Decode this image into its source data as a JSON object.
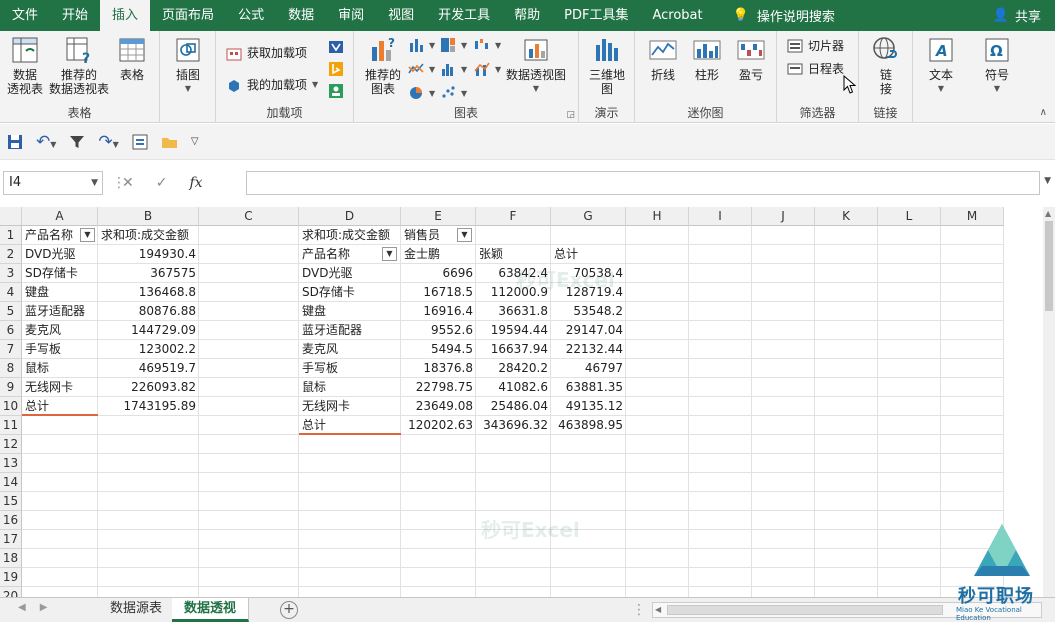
{
  "ribbon_tabs": [
    "文件",
    "开始",
    "插入",
    "页面布局",
    "公式",
    "数据",
    "审阅",
    "视图",
    "开发工具",
    "帮助",
    "PDF工具集",
    "Acrobat"
  ],
  "active_tab_index": 2,
  "tell_me": "操作说明搜索",
  "share": "共享",
  "groups": {
    "tables": {
      "label": "表格",
      "pivot": "数据\n透视表",
      "recommended_pivot": "推荐的\n数据透视表",
      "table": "表格"
    },
    "illustrations": {
      "label": "",
      "button": "插图"
    },
    "addins": {
      "label": "加载项",
      "get": "获取加载项",
      "my": "我的加载项"
    },
    "charts": {
      "label": "图表",
      "recommended": "推荐的\n图表",
      "pivot_chart": "数据透视图"
    },
    "tours": {
      "label": "演示",
      "map3d": "三维地\n图"
    },
    "sparklines": {
      "label": "迷你图",
      "line": "折线",
      "column": "柱形",
      "winloss": "盈亏"
    },
    "filters": {
      "label": "筛选器",
      "slicer": "切片器",
      "timeline": "日程表"
    },
    "links": {
      "label": "链接",
      "link": "链\n接"
    },
    "text": {
      "button": "文本"
    },
    "symbols": {
      "button": "符号"
    }
  },
  "namebox": "I4",
  "fx": "fx",
  "columns": [
    {
      "label": "A",
      "w": 76
    },
    {
      "label": "B",
      "w": 101
    },
    {
      "label": "C",
      "w": 100
    },
    {
      "label": "D",
      "w": 102
    },
    {
      "label": "E",
      "w": 75
    },
    {
      "label": "F",
      "w": 75
    },
    {
      "label": "G",
      "w": 75
    },
    {
      "label": "H",
      "w": 63
    },
    {
      "label": "I",
      "w": 63
    },
    {
      "label": "J",
      "w": 63
    },
    {
      "label": "K",
      "w": 63
    },
    {
      "label": "L",
      "w": 63
    },
    {
      "label": "M",
      "w": 63
    }
  ],
  "row_numbers": [
    "1",
    "2",
    "3",
    "4",
    "5",
    "6",
    "7",
    "8",
    "9",
    "10",
    "11",
    "12",
    "13",
    "14",
    "15",
    "16",
    "17",
    "18",
    "19",
    "20"
  ],
  "pivot1": {
    "header_label": "产品名称",
    "value_header": "求和项:成交金额",
    "rows": [
      [
        "DVD光驱",
        "194930.4"
      ],
      [
        "SD存储卡",
        "367575"
      ],
      [
        "键盘",
        "136468.8"
      ],
      [
        "蓝牙适配器",
        "80876.88"
      ],
      [
        "麦克风",
        "144729.09"
      ],
      [
        "手写板",
        "123002.2"
      ],
      [
        "鼠标",
        "469519.7"
      ],
      [
        "无线网卡",
        "226093.82"
      ],
      [
        "总计",
        "1743195.89"
      ]
    ]
  },
  "pivot2": {
    "value_header": "求和项:成交金额",
    "col_field": "销售员",
    "row_field": "产品名称",
    "col_headers": [
      "金士鹏",
      "张颖",
      "总计"
    ],
    "rows": [
      [
        "DVD光驱",
        "6696",
        "63842.4",
        "70538.4"
      ],
      [
        "SD存储卡",
        "16718.5",
        "112000.9",
        "128719.4"
      ],
      [
        "键盘",
        "16916.4",
        "36631.8",
        "53548.2"
      ],
      [
        "蓝牙适配器",
        "9552.6",
        "19594.44",
        "29147.04"
      ],
      [
        "麦克风",
        "5494.5",
        "16637.94",
        "22132.44"
      ],
      [
        "手写板",
        "18376.8",
        "28420.2",
        "46797"
      ],
      [
        "鼠标",
        "22798.75",
        "41082.6",
        "63881.35"
      ],
      [
        "无线网卡",
        "23649.08",
        "25486.04",
        "49135.12"
      ],
      [
        "总计",
        "120202.63",
        "343696.32",
        "463898.95"
      ]
    ]
  },
  "watermark": "秒可Excel",
  "sheets": [
    "数据源表",
    "数据透视"
  ],
  "active_sheet_index": 1,
  "logo": {
    "name": "秒可职场",
    "sub": "Miao Ke Vocational Education"
  }
}
